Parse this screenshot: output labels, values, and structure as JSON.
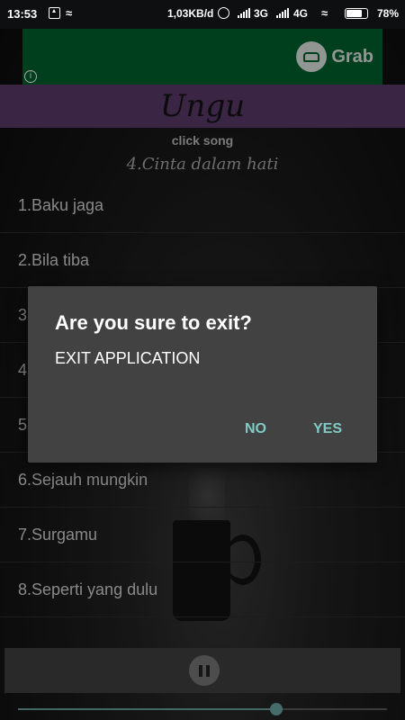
{
  "status_bar": {
    "time": "13:53",
    "speed": "1,03KB/d",
    "network_3g": "3G",
    "network_4g": "4G",
    "battery_pct": "78%",
    "battery_level": 0.78
  },
  "ad": {
    "brand": "Grab",
    "info_icon": "i",
    "background_color": "#00612d"
  },
  "header": {
    "title": "Ungu",
    "bar_color": "#5b3a6b"
  },
  "subtitle": "click song",
  "now_playing": "4.Cinta dalam hati",
  "songs": [
    "1.Baku jaga",
    "2.Bila tiba",
    "3",
    "4",
    "5",
    "6.Sejauh mungkin",
    "7.Surgamu",
    "8.Seperti yang dulu"
  ],
  "player": {
    "progress": 0.7
  },
  "dialog": {
    "title": "Are you sure to exit?",
    "message": "EXIT APPLICATION",
    "no_label": "NO",
    "yes_label": "YES",
    "button_color": "#80cbc4"
  }
}
